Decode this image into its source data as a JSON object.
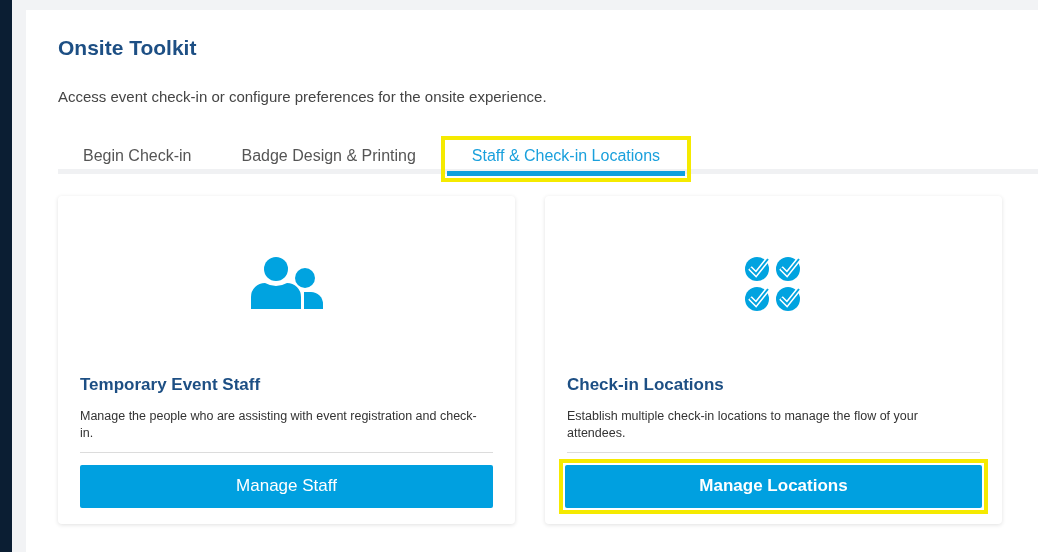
{
  "title": "Onsite Toolkit",
  "description": "Access event check-in or configure preferences for the onsite experience.",
  "tabs": [
    {
      "label": "Begin Check-in",
      "selected": false,
      "highlighted": false
    },
    {
      "label": "Badge Design & Printing",
      "selected": false,
      "highlighted": false
    },
    {
      "label": "Staff & Check-in Locations",
      "selected": true,
      "highlighted": true
    }
  ],
  "cards": [
    {
      "kind": "staff",
      "title": "Temporary Event Staff",
      "description": "Manage the people who are assisting with event registration and check-in.",
      "button": {
        "label": "Manage Staff",
        "highlighted": false
      }
    },
    {
      "kind": "locations",
      "title": "Check-in Locations",
      "description": "Establish multiple check-in locations to manage the flow of your attendees.",
      "button": {
        "label": "Manage Locations",
        "highlighted": true
      }
    }
  ]
}
